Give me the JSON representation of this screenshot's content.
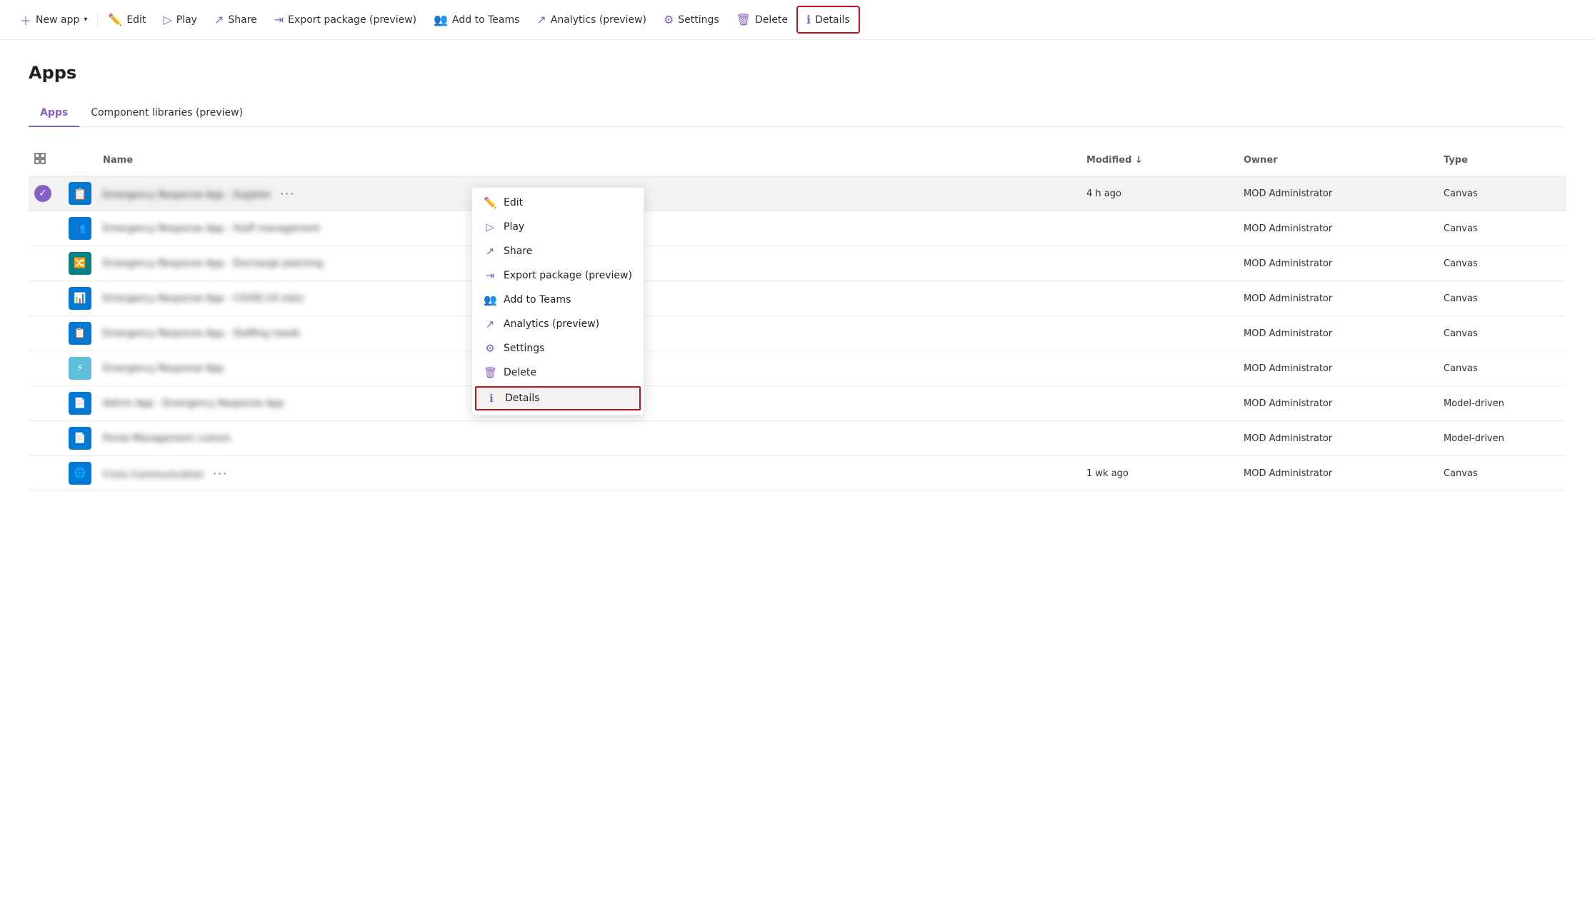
{
  "toolbar": {
    "new_app_label": "New app",
    "edit_label": "Edit",
    "play_label": "Play",
    "share_label": "Share",
    "export_label": "Export package (preview)",
    "add_to_teams_label": "Add to Teams",
    "analytics_label": "Analytics (preview)",
    "settings_label": "Settings",
    "delete_label": "Delete",
    "details_label": "Details"
  },
  "page": {
    "title": "Apps",
    "tabs": [
      {
        "label": "Apps",
        "active": true
      },
      {
        "label": "Component libraries (preview)",
        "active": false
      }
    ]
  },
  "table": {
    "columns": [
      "",
      "",
      "Name",
      "Modified ↓",
      "Owner",
      "Type"
    ],
    "rows": [
      {
        "selected": true,
        "icon_color": "blue",
        "icon": "📋",
        "name": "Emergency Response App - Supplier",
        "modified": "4 h ago",
        "owner": "MOD Administrator",
        "type": "Canvas",
        "show_more": true
      },
      {
        "selected": false,
        "icon_color": "blue",
        "icon": "👥",
        "name": "Emergency Response App - Staff management",
        "modified": "",
        "owner": "MOD Administrator",
        "type": "Canvas",
        "show_more": false
      },
      {
        "selected": false,
        "icon_color": "teal",
        "icon": "🔀",
        "name": "Emergency Response App - Discharge planning",
        "modified": "",
        "owner": "MOD Administrator",
        "type": "Canvas",
        "show_more": false
      },
      {
        "selected": false,
        "icon_color": "blue",
        "icon": "📊",
        "name": "Emergency Response App - COVID-19 stats",
        "modified": "",
        "owner": "MOD Administrator",
        "type": "Canvas",
        "show_more": false
      },
      {
        "selected": false,
        "icon_color": "blue",
        "icon": "📋",
        "name": "Emergency Response App - Staffing needs",
        "modified": "",
        "owner": "MOD Administrator",
        "type": "Canvas",
        "show_more": false
      },
      {
        "selected": false,
        "icon_color": "light-blue",
        "icon": "⚡",
        "name": "Emergency Response App",
        "modified": "",
        "owner": "MOD Administrator",
        "type": "Canvas",
        "show_more": false
      },
      {
        "selected": false,
        "icon_color": "blue",
        "icon": "📄",
        "name": "Admin App - Emergency Response App",
        "modified": "",
        "owner": "MOD Administrator",
        "type": "Model-driven",
        "show_more": false
      },
      {
        "selected": false,
        "icon_color": "blue",
        "icon": "📄",
        "name": "Portal Management custom",
        "modified": "",
        "owner": "MOD Administrator",
        "type": "Model-driven",
        "show_more": false
      },
      {
        "selected": false,
        "icon_color": "globe",
        "icon": "🌐",
        "name": "Crisis Communication",
        "modified": "1 wk ago",
        "owner": "MOD Administrator",
        "type": "Canvas",
        "show_more": true
      }
    ]
  },
  "context_menu": {
    "items": [
      {
        "label": "Edit",
        "icon": "edit"
      },
      {
        "label": "Play",
        "icon": "play"
      },
      {
        "label": "Share",
        "icon": "share"
      },
      {
        "label": "Export package (preview)",
        "icon": "export"
      },
      {
        "label": "Add to Teams",
        "icon": "teams"
      },
      {
        "label": "Analytics (preview)",
        "icon": "analytics"
      },
      {
        "label": "Settings",
        "icon": "settings"
      },
      {
        "label": "Delete",
        "icon": "delete"
      },
      {
        "label": "Details",
        "icon": "info",
        "highlighted": true
      }
    ]
  }
}
